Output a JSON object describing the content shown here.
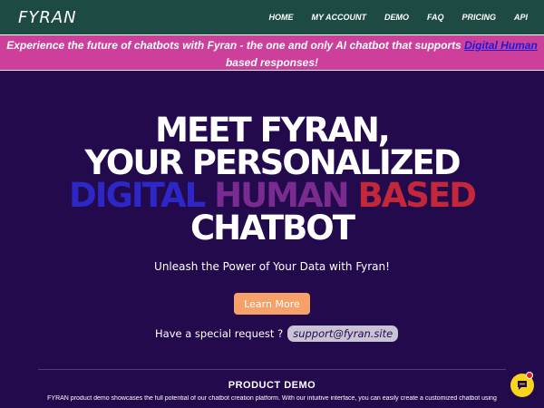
{
  "nav": {
    "logo": "FYRAN",
    "links": [
      "HOME",
      "MY ACCOUNT",
      "DEMO",
      "FAQ",
      "PRICING",
      "API"
    ]
  },
  "banner": {
    "text_before": "Experience the future of chatbots with Fyran - the one and only AI chatbot that supports ",
    "highlight": "Digital Human",
    "text_after": " based responses!"
  },
  "hero": {
    "line1": "MEET FYRAN,",
    "line2": "YOUR PERSONALIZED",
    "line3_word1": "DIGITAL",
    "line3_word2": "HUMAN",
    "line3_word3": "BASED",
    "line4": "CHATBOT",
    "tagline": "Unleash the Power of Your Data with Fyran!",
    "cta_label": "Learn More",
    "special_request_label": "Have a special request ?",
    "support_email": "support@fyran.site"
  },
  "product_demo": {
    "title": "PRODUCT DEMO",
    "description": "FYRAN product demo showcases the full potential of our chatbot creation platform. With our intuitive interface, you can easily create a customized chatbot using"
  },
  "colors": {
    "nav_bg": "#1e4a44",
    "banner_bg": "#cc3f9a",
    "page_bg": "#220a4c",
    "cta_bg": "#f6a06a",
    "fab_bg": "#f7d51d"
  },
  "icons": {
    "chat_fab": "chat-bubble-icon"
  }
}
